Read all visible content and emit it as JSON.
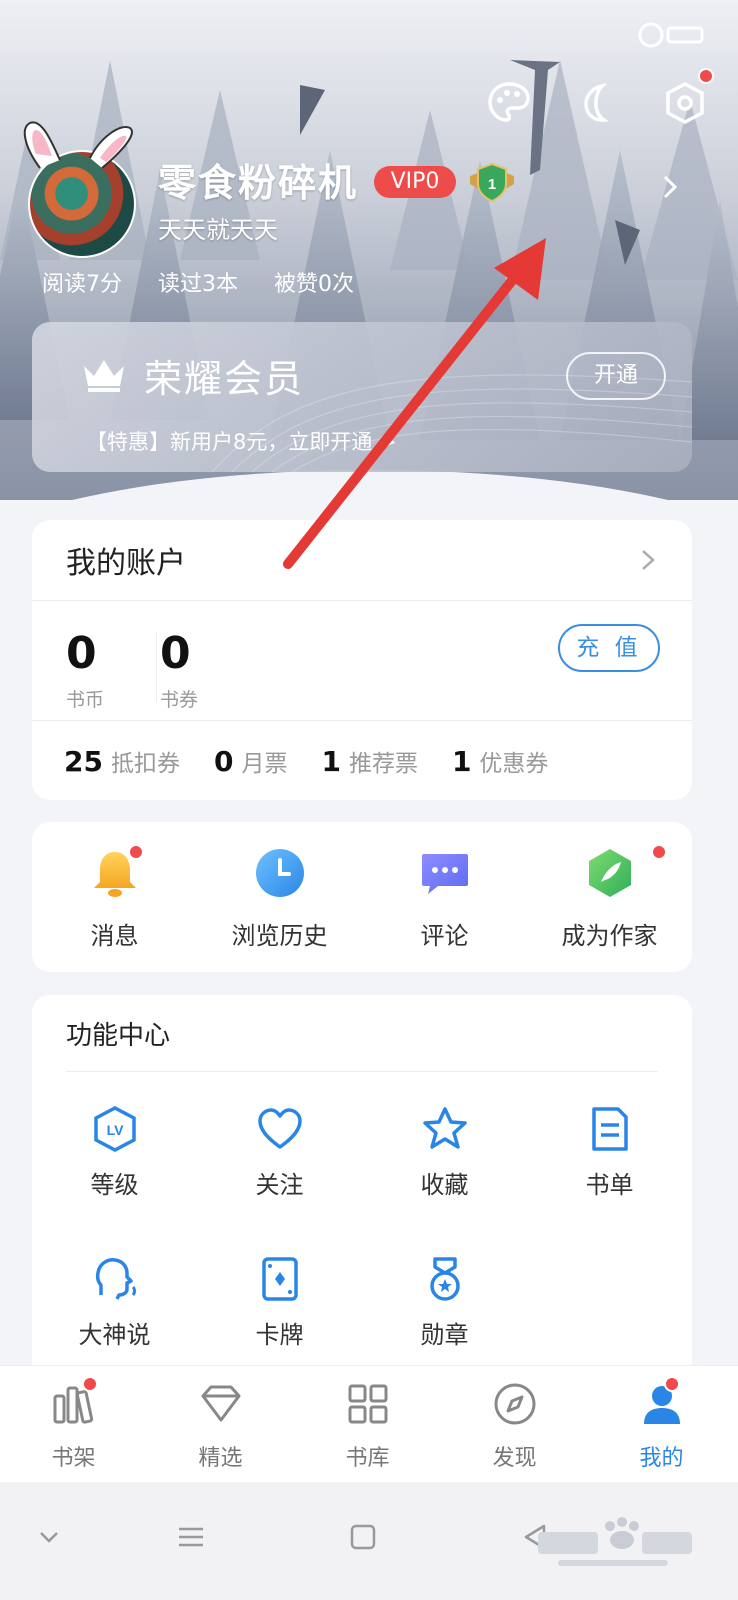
{
  "profile": {
    "username": "零食粉碎机",
    "vip_label": "VIP0",
    "level_badge": "1",
    "subtitle": "天天就天天",
    "stats": [
      "阅读7分",
      "读过3本",
      "被赞0次"
    ]
  },
  "top_icons": [
    "palette-icon",
    "moon-icon",
    "settings-hexagon-icon"
  ],
  "vip_card": {
    "title": "荣耀会员",
    "open_label": "开通",
    "promo": "【特惠】新用户8元，立即开通 >"
  },
  "account": {
    "title": "我的账户",
    "book_coin_value": "0",
    "book_coin_label": "书币",
    "book_coupon_value": "0",
    "book_coupon_label": "书券",
    "recharge_label": "充 值",
    "tickets": [
      {
        "count": "25",
        "label": "抵扣券"
      },
      {
        "count": "0",
        "label": "月票"
      },
      {
        "count": "1",
        "label": "推荐票"
      },
      {
        "count": "1",
        "label": "优惠券"
      }
    ]
  },
  "shortcuts": [
    {
      "label": "消息",
      "icon": "bell-icon",
      "has_dot": true
    },
    {
      "label": "浏览历史",
      "icon": "clock-icon",
      "has_dot": false
    },
    {
      "label": "评论",
      "icon": "comment-icon",
      "has_dot": false
    },
    {
      "label": "成为作家",
      "icon": "writer-icon",
      "has_dot": true
    }
  ],
  "function_center": {
    "title": "功能中心",
    "items": [
      {
        "label": "等级",
        "icon": "level-icon"
      },
      {
        "label": "关注",
        "icon": "heart-icon"
      },
      {
        "label": "收藏",
        "icon": "star-icon"
      },
      {
        "label": "书单",
        "icon": "booklist-icon"
      },
      {
        "label": "大神说",
        "icon": "talk-icon"
      },
      {
        "label": "卡牌",
        "icon": "card-icon"
      },
      {
        "label": "勋章",
        "icon": "medal-icon"
      }
    ]
  },
  "bottom_nav": [
    {
      "label": "书架",
      "icon": "bookshelf-icon",
      "has_dot": true,
      "active": false
    },
    {
      "label": "精选",
      "icon": "diamond-icon",
      "has_dot": false,
      "active": false
    },
    {
      "label": "书库",
      "icon": "grid-icon",
      "has_dot": false,
      "active": false
    },
    {
      "label": "发现",
      "icon": "compass-icon",
      "has_dot": false,
      "active": false
    },
    {
      "label": "我的",
      "icon": "user-icon",
      "has_dot": true,
      "active": true
    }
  ],
  "colors": {
    "accent": "#2a86e6",
    "vip_red": "#ee4c4a",
    "dot_red": "#f04b4b"
  }
}
